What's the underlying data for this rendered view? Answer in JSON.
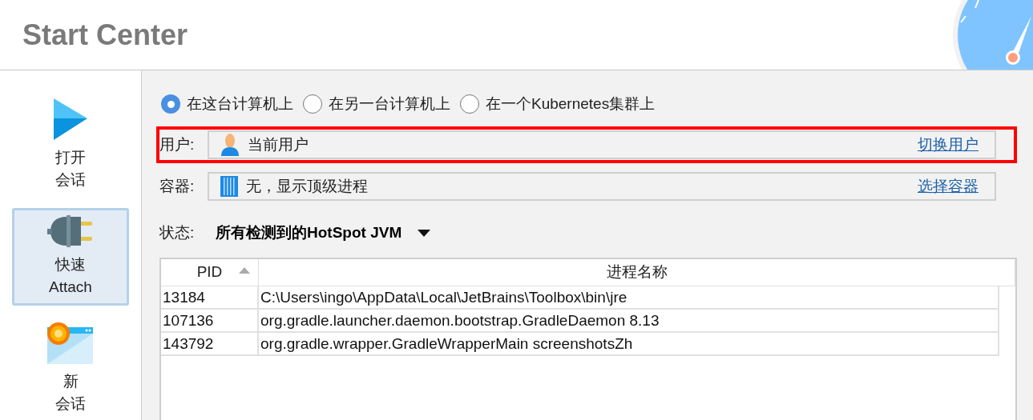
{
  "header": {
    "title": "Start Center"
  },
  "sidebar": {
    "items": [
      {
        "kind": "play",
        "lines": [
          "打开",
          "会话"
        ],
        "selected": false
      },
      {
        "kind": "plug",
        "lines": [
          "快速",
          "Attach"
        ],
        "selected": true
      },
      {
        "kind": "window",
        "lines": [
          "新",
          "会话"
        ],
        "selected": false
      }
    ]
  },
  "target": {
    "options": [
      {
        "label": "在这台计算机上",
        "selected": true
      },
      {
        "label": "在另一台计算机上",
        "selected": false
      },
      {
        "label": "在一个Kubernetes集群上",
        "selected": false
      }
    ]
  },
  "fields": [
    {
      "kind": "user",
      "label": "用户:",
      "value": "当前用户",
      "link": "切换用户",
      "highlighted": true
    },
    {
      "kind": "container",
      "label": "容器:",
      "value": "无，显示顶级进程",
      "link": "选择容器",
      "highlighted": false
    }
  ],
  "filter": {
    "label": "状态:",
    "value": "所有检测到的HotSpot JVM"
  },
  "table": {
    "columns": [
      {
        "label": "PID",
        "sorted": true
      },
      {
        "label": "进程名称",
        "sorted": false
      }
    ],
    "rows": [
      [
        "13184",
        "C:\\Users\\ingo\\AppData\\Local\\JetBrains\\Toolbox\\bin\\jre"
      ],
      [
        "107136",
        "org.gradle.launcher.daemon.bootstrap.GradleDaemon 8.13"
      ],
      [
        "143792",
        "org.gradle.wrapper.GradleWrapperMain screenshotsZh"
      ]
    ]
  }
}
